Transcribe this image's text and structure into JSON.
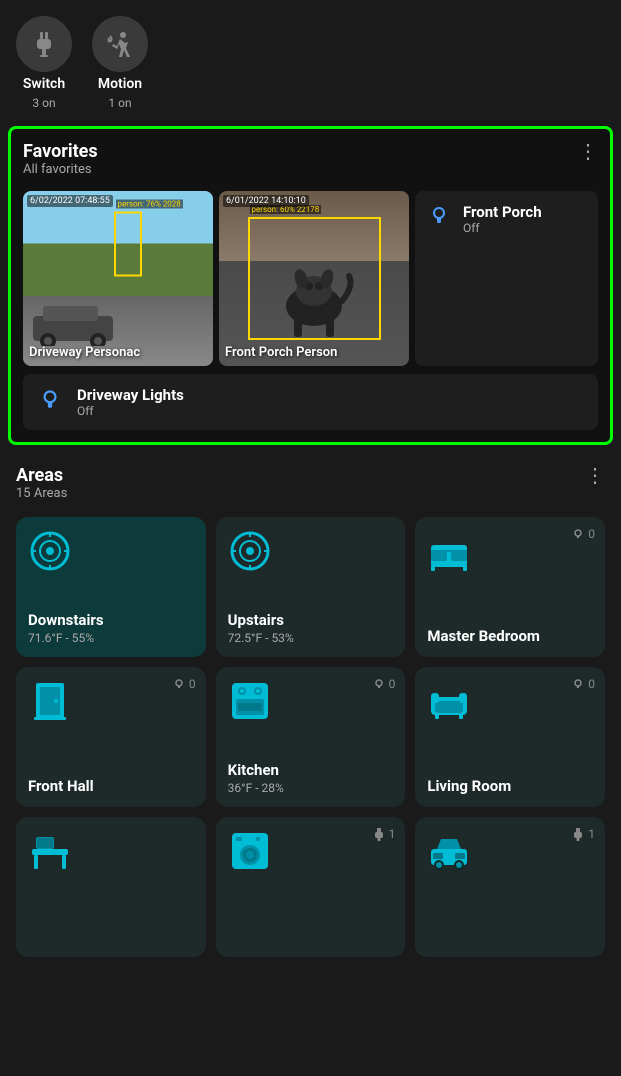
{
  "top": {
    "devices": [
      {
        "id": "switch",
        "label": "Switch",
        "sublabel": "3 on",
        "icon": "plug"
      },
      {
        "id": "motion",
        "label": "Motion",
        "sublabel": "1 on",
        "icon": "motion"
      }
    ]
  },
  "favorites": {
    "title": "Favorites",
    "subtitle": "All favorites",
    "menu_icon": "⋮",
    "cameras": [
      {
        "id": "driveway-personac",
        "label": "Driveway Personac",
        "timestamp": "6/02/2022 07:48:55",
        "detection": "person: 76% 2028",
        "type": "driveway"
      },
      {
        "id": "front-porch-person",
        "label": "Front Porch Person",
        "timestamp": "6/01/2022 14:10:10",
        "detection": "person: 60% 22178",
        "type": "frontporch"
      }
    ],
    "light": {
      "name": "Front Porch",
      "status": "Off"
    },
    "driveway_lights": {
      "name": "Driveway Lights",
      "status": "Off"
    }
  },
  "areas": {
    "title": "Areas",
    "subtitle": "15 Areas",
    "menu_icon": "⋮",
    "items": [
      {
        "id": "downstairs",
        "name": "Downstairs",
        "temp": "71.6°F - 55%",
        "icon": "thermostat",
        "active": true,
        "light_count": null,
        "plug_count": null
      },
      {
        "id": "upstairs",
        "name": "Upstairs",
        "temp": "72.5°F - 53%",
        "icon": "thermostat",
        "active": false,
        "light_count": null,
        "plug_count": null
      },
      {
        "id": "master-bedroom",
        "name": "Master Bedroom",
        "temp": "",
        "icon": "bed",
        "active": false,
        "light_count": 0,
        "plug_count": null
      },
      {
        "id": "front-hall",
        "name": "Front Hall",
        "temp": "",
        "icon": "door",
        "active": false,
        "light_count": 0,
        "plug_count": null
      },
      {
        "id": "kitchen",
        "name": "Kitchen",
        "temp": "36°F - 28%",
        "icon": "stove",
        "active": false,
        "light_count": 0,
        "plug_count": null
      },
      {
        "id": "living-room",
        "name": "Living Room",
        "temp": "",
        "icon": "sofa",
        "active": false,
        "light_count": 0,
        "plug_count": null
      },
      {
        "id": "area-7",
        "name": "",
        "temp": "",
        "icon": "desk",
        "active": false,
        "light_count": null,
        "plug_count": null
      },
      {
        "id": "area-8",
        "name": "",
        "temp": "",
        "icon": "washer",
        "active": false,
        "light_count": null,
        "plug_count": 1
      },
      {
        "id": "area-9",
        "name": "",
        "temp": "",
        "icon": "car",
        "active": false,
        "light_count": null,
        "plug_count": 1
      }
    ]
  }
}
